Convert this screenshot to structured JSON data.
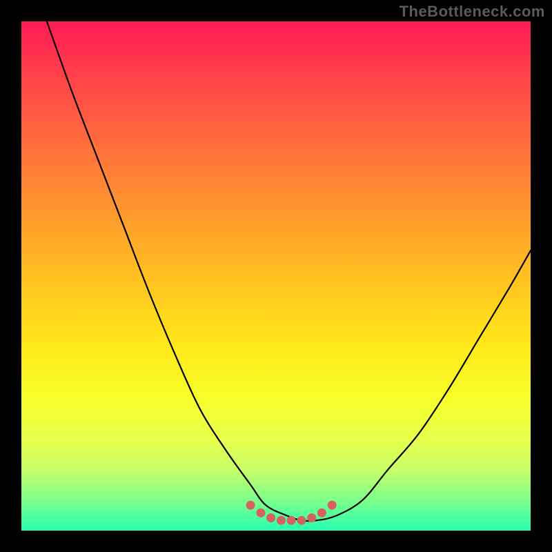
{
  "watermark": "TheBottleneck.com",
  "chart_data": {
    "type": "line",
    "title": "",
    "xlabel": "",
    "ylabel": "",
    "xlim": [
      0,
      100
    ],
    "ylim": [
      0,
      100
    ],
    "grid": false,
    "series": [
      {
        "name": "curve",
        "x": [
          5,
          10,
          15,
          20,
          25,
          30,
          35,
          40,
          45,
          48,
          52,
          55,
          58,
          62,
          67,
          72,
          78,
          84,
          90,
          96,
          100
        ],
        "values": [
          100,
          86,
          73,
          60,
          47,
          35,
          24,
          16,
          9,
          5,
          3,
          2,
          2,
          3,
          6,
          12,
          19,
          28,
          38,
          48,
          55
        ]
      }
    ],
    "markers": {
      "name": "bottom-dots",
      "x": [
        45,
        47,
        49,
        51,
        53,
        55,
        57,
        59,
        61
      ],
      "values": [
        5,
        3.5,
        2.5,
        2,
        2,
        2,
        2.5,
        3.5,
        5
      ]
    },
    "background_gradient": {
      "top": "#ff1a55",
      "bottom": "#26ffb0"
    }
  }
}
